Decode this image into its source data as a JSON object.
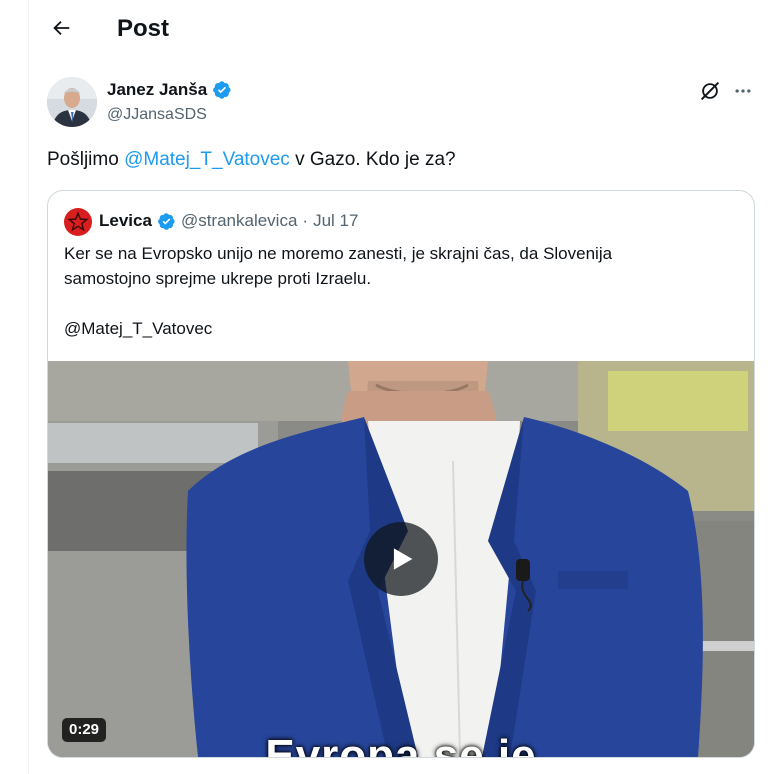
{
  "header": {
    "title": "Post"
  },
  "post": {
    "author_name": "Janez Janša",
    "author_handle": "@JJansaSDS",
    "text_before": "Pošljimo ",
    "mention": "@Matej_T_Vatovec",
    "text_after": " v Gazo. Kdo je za?"
  },
  "quote": {
    "author_name": "Levica",
    "author_handle": "@strankalevica",
    "separator": "·",
    "date": "Jul 17",
    "line1": "Ker se na Evropsko unijo ne moremo zanesti, je skrajni čas, da Slovenija",
    "line2": "samostojno sprejme ukrepe proti Izraelu.",
    "line3": "@Matej_T_Vatovec",
    "video": {
      "duration": "0:29",
      "caption": "Evropa se je"
    }
  },
  "colors": {
    "accent": "#1d9bf0",
    "verified": "#1d9bf0",
    "secondary_text": "#536471",
    "border": "#cfd9de",
    "party_red": "#d81e1e"
  },
  "icons": {
    "back": "arrow-left-icon",
    "grok": "grok-icon",
    "more": "more-icon",
    "verified": "verified-badge-icon",
    "play": "play-icon"
  }
}
